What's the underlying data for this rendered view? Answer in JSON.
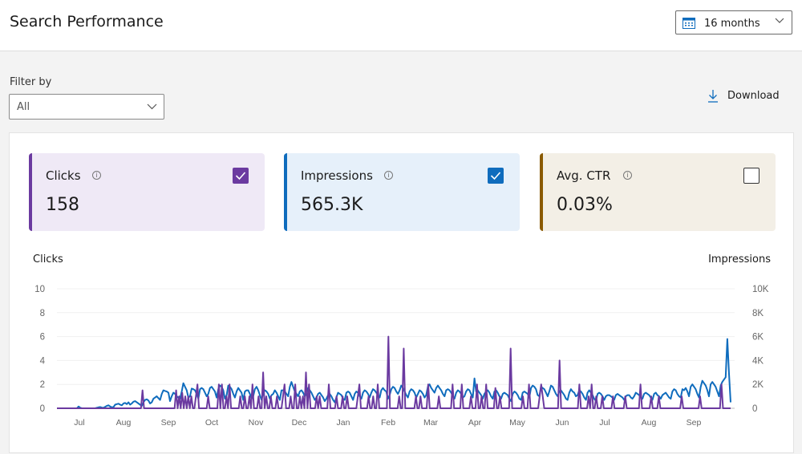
{
  "header": {
    "title": "Search Performance",
    "date_range": "16 months"
  },
  "filter": {
    "label": "Filter by",
    "value": "All"
  },
  "download_label": "Download",
  "cards": [
    {
      "label": "Clicks",
      "value": "158",
      "checked": true,
      "color": "#6b3aa0",
      "bg": "#efe9f6"
    },
    {
      "label": "Impressions",
      "value": "565.3K",
      "checked": true,
      "color": "#0f6cbd",
      "bg": "#e6f0fa"
    },
    {
      "label": "Avg. CTR",
      "value": "0.03%",
      "checked": false,
      "color": "#8a5a00",
      "bg": "#f3efe6"
    }
  ],
  "info_glyph": "i",
  "chart_data": {
    "type": "line",
    "left_axis_title": "Clicks",
    "right_axis_title": "Impressions",
    "left_ylim": [
      0,
      10
    ],
    "right_ylim": [
      0,
      10000
    ],
    "left_ticks": [
      "0",
      "2",
      "4",
      "6",
      "8",
      "10"
    ],
    "right_ticks": [
      "0",
      "2K",
      "4K",
      "6K",
      "8K",
      "10K"
    ],
    "x_ticks": [
      "Jul",
      "Aug",
      "Sep",
      "Oct",
      "Nov",
      "Dec",
      "Jan",
      "Feb",
      "Mar",
      "Apr",
      "May",
      "Jun",
      "Jul",
      "Aug",
      "Sep"
    ],
    "grid": true,
    "series": [
      {
        "name": "Impressions",
        "axis": "right",
        "color": "#0f6cbd",
        "description": "Daily impressions, mid-June to late September; low (~0-500) through July, rising to ~1-2K by September and fluctuating 500-2.5K, peak ~5.8K in late September",
        "values": [
          0,
          0,
          0,
          0,
          0,
          0,
          0,
          0,
          0,
          0,
          0,
          0,
          0,
          150,
          50,
          0,
          0,
          0,
          0,
          0,
          0,
          0,
          0,
          0,
          50,
          80,
          100,
          60,
          40,
          120,
          200,
          250,
          150,
          80,
          100,
          300,
          350,
          380,
          300,
          250,
          400,
          450,
          350,
          500,
          300,
          400,
          550,
          600,
          500,
          400,
          300,
          200,
          500,
          700,
          750,
          650,
          400,
          500,
          800,
          900,
          1000,
          850,
          700,
          1200,
          1500,
          1450,
          1400,
          1300,
          600,
          1000,
          1300,
          1200,
          1000,
          900,
          800,
          1400,
          2100,
          1800,
          1500,
          900,
          1000,
          1650,
          1600,
          1500,
          1200,
          800,
          1600,
          1700,
          1600,
          1300,
          1000,
          1200,
          1700,
          1800,
          1600,
          1400,
          900,
          1600,
          1900,
          1800,
          1500,
          800,
          1100,
          1900,
          1800,
          1600,
          1200,
          900,
          1400,
          1700,
          1500,
          1300,
          700,
          1400,
          1500,
          1500,
          1200,
          800,
          1000,
          1600,
          1800,
          1500,
          1100,
          700,
          1300,
          1500,
          1400,
          1200,
          800,
          1100,
          1200,
          1500,
          1300,
          1000,
          700,
          1500,
          1500,
          1400,
          1200,
          1000,
          1800,
          2200,
          1800,
          1400,
          1200,
          1000,
          1400,
          1500,
          1300,
          1000,
          1200,
          1700,
          1500,
          1300,
          1000,
          700,
          900,
          1200,
          1300,
          1100,
          900,
          600,
          800,
          1100,
          1200,
          1000,
          700,
          500,
          900,
          1300,
          1200,
          1100,
          800,
          700,
          1300,
          1400,
          1300,
          1000,
          700,
          1200,
          1400,
          1300,
          1000,
          800,
          1300,
          1500,
          1400,
          1200,
          900,
          1300,
          1600,
          1500,
          1300,
          1100,
          900,
          1500,
          1700,
          1500,
          1400,
          800,
          1100,
          1600,
          1800,
          1700,
          1400,
          1200,
          1500,
          1900,
          1700,
          1400,
          1100,
          900,
          1400,
          1600,
          1500,
          1300,
          900,
          1200,
          1500,
          1400,
          1200,
          900,
          1100,
          1800,
          2000,
          1700,
          1500,
          1300,
          1700,
          1900,
          1700,
          1500,
          1200,
          1000,
          1500,
          1600,
          1500,
          1300,
          1000,
          800,
          1300,
          1500,
          1400,
          1200,
          900,
          1000,
          1400,
          1600,
          1500,
          1200,
          900,
          2500,
          1400,
          1500,
          1300,
          1100,
          800,
          1200,
          1400,
          1500,
          1300,
          1000,
          800,
          1400,
          1500,
          1300,
          1000,
          800,
          1200,
          1300,
          1200,
          1100,
          800,
          600,
          1200,
          1400,
          1300,
          1100,
          800,
          700,
          1300,
          1400,
          1300,
          1200,
          900,
          1700,
          1900,
          1800,
          1600,
          1100,
          1000,
          1800,
          1700,
          1600,
          1300,
          1000,
          1400,
          1900,
          1800,
          1500,
          1200,
          1000,
          1400,
          1500,
          1300,
          1100,
          800,
          700,
          1300,
          1600,
          1400,
          1300,
          1000,
          1100,
          1500,
          1400,
          1200,
          900,
          700,
          1300,
          1500,
          1300,
          1100,
          800,
          600,
          1200,
          1300,
          1200,
          1000,
          700,
          1000,
          1100,
          1100,
          1000,
          900,
          700,
          1100,
          1200,
          1100,
          1000,
          900,
          700,
          1000,
          1100,
          1100,
          900,
          800,
          1000,
          1300,
          1200,
          1100,
          900,
          800,
          1200,
          1300,
          1200,
          1100,
          900,
          700,
          1200,
          1300,
          1100,
          1000,
          800,
          1100,
          1200,
          1300,
          1100,
          900,
          800,
          1400,
          1600,
          1500,
          1200,
          1000,
          900,
          1600,
          1500,
          1700,
          1400,
          1000,
          1800,
          2000,
          1800,
          1600,
          1200,
          900,
          1800,
          2300,
          2100,
          1900,
          1500,
          1000,
          2000,
          2200,
          2000,
          1800,
          1400,
          1000,
          1900,
          2200,
          2400,
          2600,
          5800,
          3000,
          500
        ]
      },
      {
        "name": "Clicks",
        "axis": "left",
        "color": "#6b3aa0",
        "description": "Daily clicks, mostly 0 with frequent spikes of 1-2, max 6 in early February",
        "values": [
          0,
          0,
          0,
          0,
          0,
          0,
          0,
          0,
          0,
          0,
          0,
          0,
          0,
          0,
          0,
          0,
          0,
          0,
          0,
          0,
          0,
          0,
          0,
          0,
          0,
          0,
          0,
          0,
          0,
          0,
          0,
          0,
          0,
          0,
          0,
          0,
          0,
          0,
          0,
          0,
          0,
          0,
          0,
          0,
          0,
          0,
          0,
          0,
          0,
          0,
          0,
          0,
          0,
          0,
          0,
          0,
          1.5,
          0,
          0,
          0,
          0,
          0,
          0,
          0,
          0,
          0,
          0,
          0,
          0,
          0,
          0,
          0,
          0,
          0,
          0,
          0,
          0,
          0,
          1.5,
          0,
          1,
          0,
          1.3,
          0,
          1,
          0,
          1,
          0,
          1,
          0,
          0,
          1,
          2,
          0,
          0,
          0,
          0,
          0,
          0,
          1,
          0,
          0,
          0,
          0,
          0,
          0,
          2,
          0,
          2,
          0,
          0,
          1,
          0,
          2,
          0,
          0,
          0,
          0,
          0,
          0,
          1,
          0,
          0,
          1,
          0,
          0,
          1,
          0,
          2,
          0,
          0,
          0,
          1,
          0,
          0,
          3,
          0,
          1,
          0,
          0,
          1,
          0,
          0,
          0,
          1,
          0,
          0,
          0,
          1,
          2,
          0,
          0,
          0,
          1,
          0,
          0,
          2,
          0,
          0,
          1,
          0,
          1,
          0,
          3,
          0,
          2,
          0,
          0,
          0,
          0,
          1,
          0,
          1,
          0,
          0,
          0,
          0,
          0,
          2,
          0,
          0,
          0,
          0,
          1,
          0,
          0,
          0,
          1,
          0,
          0,
          1,
          0,
          0,
          0,
          0,
          0,
          0,
          1,
          2,
          0,
          0,
          0,
          0,
          0,
          1,
          0,
          0,
          1,
          0,
          0,
          2,
          0,
          0,
          0,
          0,
          0,
          0,
          6,
          0,
          0,
          0,
          0,
          0,
          0,
          1,
          0,
          0,
          5,
          0,
          0,
          0,
          0,
          0,
          0,
          0,
          1,
          0,
          0,
          1,
          0,
          0,
          0,
          0,
          2,
          0,
          0,
          0,
          0,
          0,
          0,
          1,
          0,
          0,
          0,
          0,
          0,
          0,
          0,
          0,
          2,
          0,
          0,
          0,
          0,
          0,
          2,
          0,
          0,
          0,
          0,
          0,
          1,
          0,
          0,
          0,
          2,
          0,
          0,
          1,
          0,
          0,
          2,
          0,
          0,
          0,
          0,
          0,
          1.7,
          0,
          0,
          1,
          0,
          0,
          0,
          0,
          0,
          0,
          5,
          0,
          0,
          0,
          0,
          0,
          0,
          0,
          1,
          0,
          0,
          0,
          2,
          0,
          0,
          0,
          0,
          0,
          0,
          1,
          2,
          1,
          0,
          0,
          0,
          0,
          0,
          0,
          0,
          0,
          0,
          0,
          4,
          0,
          0,
          0,
          0,
          0,
          0,
          0,
          0,
          0,
          0,
          0,
          0,
          2,
          0,
          0,
          0,
          0,
          0,
          1,
          0,
          2,
          0,
          0,
          1,
          0,
          0,
          0,
          1,
          0,
          0,
          0,
          0,
          0,
          0,
          1,
          0,
          0,
          0,
          0,
          0,
          0,
          0,
          1,
          0,
          0,
          0,
          0,
          0,
          0,
          0,
          0,
          0,
          2,
          0,
          0,
          0,
          0,
          0,
          0,
          1,
          0,
          0,
          0,
          0,
          1,
          0,
          0,
          0,
          0,
          0,
          0,
          0,
          0,
          0,
          0,
          0,
          0,
          0,
          0,
          1,
          0,
          0,
          0,
          0,
          0,
          0,
          0,
          0,
          0,
          0,
          0,
          1,
          0,
          0,
          0,
          0,
          0,
          0,
          0,
          0,
          0,
          0,
          0,
          0,
          0,
          2,
          0,
          0,
          0,
          0,
          0,
          0
        ]
      }
    ]
  }
}
